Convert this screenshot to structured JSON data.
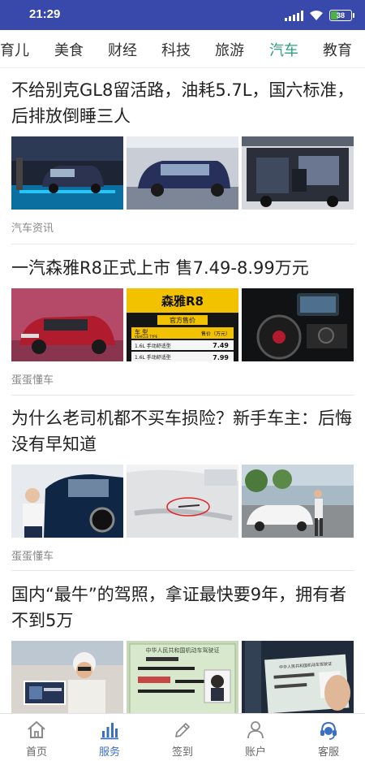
{
  "status_bar": {
    "time": "21:29",
    "battery_level": "38",
    "battery_fraction": 0.38
  },
  "tabs": [
    {
      "label": "育儿",
      "active": false
    },
    {
      "label": "美食",
      "active": false
    },
    {
      "label": "财经",
      "active": false
    },
    {
      "label": "科技",
      "active": false
    },
    {
      "label": "旅游",
      "active": false
    },
    {
      "label": "汽车",
      "active": true
    },
    {
      "label": "教育",
      "active": false
    }
  ],
  "articles": [
    {
      "title": "不给别克GL8留活路，油耗5.7L，国六标准，后排放倒睡三人",
      "source": "汽车资讯"
    },
    {
      "title": "一汽森雅R8正式上市 售7.49-8.99万元",
      "source": "蛋蛋懂车"
    },
    {
      "title": "为什么老司机都不买车损险？新手车主：后悔没有早知道",
      "source": "蛋蛋懂车"
    },
    {
      "title": "国内“最牛”的驾照，拿证最快要9年，拥有者不到5万",
      "source": ""
    }
  ],
  "image_text": {
    "senya_name": "森雅R8",
    "official_price": "官方售价",
    "col_model": "车 型",
    "col_model_en": "VEHICLE TYPE",
    "col_price": "售价（万元）",
    "row1_model": "1.6L 手动舒适型",
    "row1_price": "7.49",
    "row2_model": "1.6L 手动舒适型",
    "row2_price": "7.99",
    "license_header": "中华人民共和国机动车驾驶证",
    "license_header2": "中华人民共和国机动车驾驶证"
  },
  "bottom_nav": [
    {
      "label": "首页",
      "icon": "home-icon",
      "active": false
    },
    {
      "label": "服务",
      "icon": "bar-chart-icon",
      "active": true
    },
    {
      "label": "签到",
      "icon": "pencil-icon",
      "active": false
    },
    {
      "label": "账户",
      "icon": "person-icon",
      "active": false
    },
    {
      "label": "客服",
      "icon": "headset-icon",
      "active": false
    }
  ],
  "colors": {
    "status_bar": "#3949ab",
    "tab_active": "#2e9e83",
    "nav_active": "#3b6fc4",
    "battery": "#4caf50"
  }
}
